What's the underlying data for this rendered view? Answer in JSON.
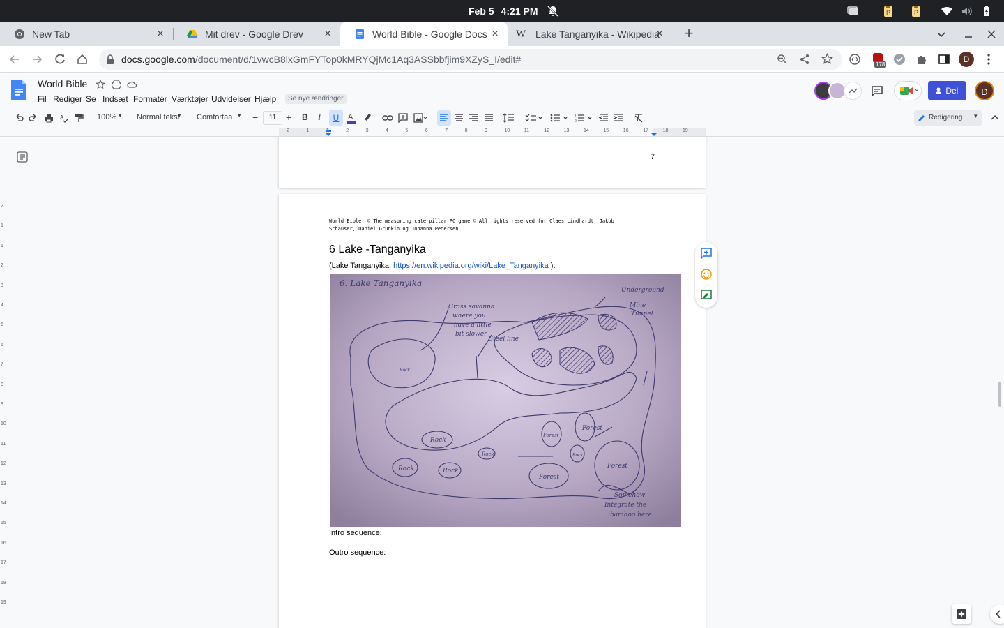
{
  "system": {
    "date": "Feb 5",
    "time": "4:21 PM"
  },
  "tabs": [
    {
      "label": "New Tab",
      "icon": "chrome-icon"
    },
    {
      "label": "Mit drev - Google Drev",
      "icon": "google-drive-icon"
    },
    {
      "label": "World Bible - Google Docs",
      "icon": "google-docs-icon"
    },
    {
      "label": "Lake Tanganyika - Wikipedia",
      "icon": "wikipedia-icon"
    }
  ],
  "address": {
    "domain": "docs.google.com",
    "path": "/document/d/1vwcB8lxGmFYTop0kMRYQjMc1Aq3ASSbbfjim9XZyS_I/edit#"
  },
  "extension_badge": "178",
  "profile_initial": "D",
  "docs": {
    "title": "World Bible",
    "menu": [
      "Fil",
      "Rediger",
      "Se",
      "Indsæt",
      "Formatér",
      "Værktøjer",
      "Udvidelser",
      "Hjælp"
    ],
    "see_changes": "Se nye ændringer",
    "share_label": "Del",
    "user_initial": "D"
  },
  "toolbar": {
    "zoom": "100%",
    "style": "Normal tekst",
    "font": "Comfortaa",
    "font_size": "11",
    "mode": "Redigering"
  },
  "ruler_numbers": [
    "2",
    "1",
    "1",
    "2",
    "3",
    "4",
    "5",
    "6",
    "7",
    "8",
    "9",
    "10",
    "11",
    "12",
    "13",
    "14",
    "15",
    "16",
    "17",
    "18",
    "19"
  ],
  "vruler_numbers": [
    "2",
    "1",
    "1",
    "2",
    "3",
    "4",
    "5",
    "6",
    "7",
    "8",
    "9",
    "10",
    "11",
    "12",
    "13",
    "14",
    "15",
    "16",
    "17",
    "18",
    "19"
  ],
  "document": {
    "prev_page_number": "7",
    "header_line1": "World Bible, © The measuring caterpillar PC game © All rights reserved for Claes Lindhardt, Jakob",
    "header_line2": "Schauser, Daniel Grunkin og Johanna Pedersen",
    "heading": "6 Lake -Tanganyika",
    "link_prefix": "(Lake Tanganyika: ",
    "link_url": "https://en.wikipedia.org/wiki/Lake_Tanganyika",
    "link_suffix": " ):",
    "intro": "Intro sequence:",
    "outro": "Outro sequence:",
    "sketch": {
      "title": "6. Lake Tanganyika",
      "notes": [
        "Grass savanna",
        "where you",
        "have a little",
        "bit slower",
        "Underground",
        "Mine",
        "Tunnel",
        "Steel line",
        "Somehow",
        "Integrate the",
        "bamboo here"
      ],
      "labels": [
        "Rock",
        "Rock",
        "Rock",
        "Rock",
        "Forest",
        "Forest",
        "Forest",
        "Forest",
        "Rock",
        "Rock"
      ]
    }
  }
}
